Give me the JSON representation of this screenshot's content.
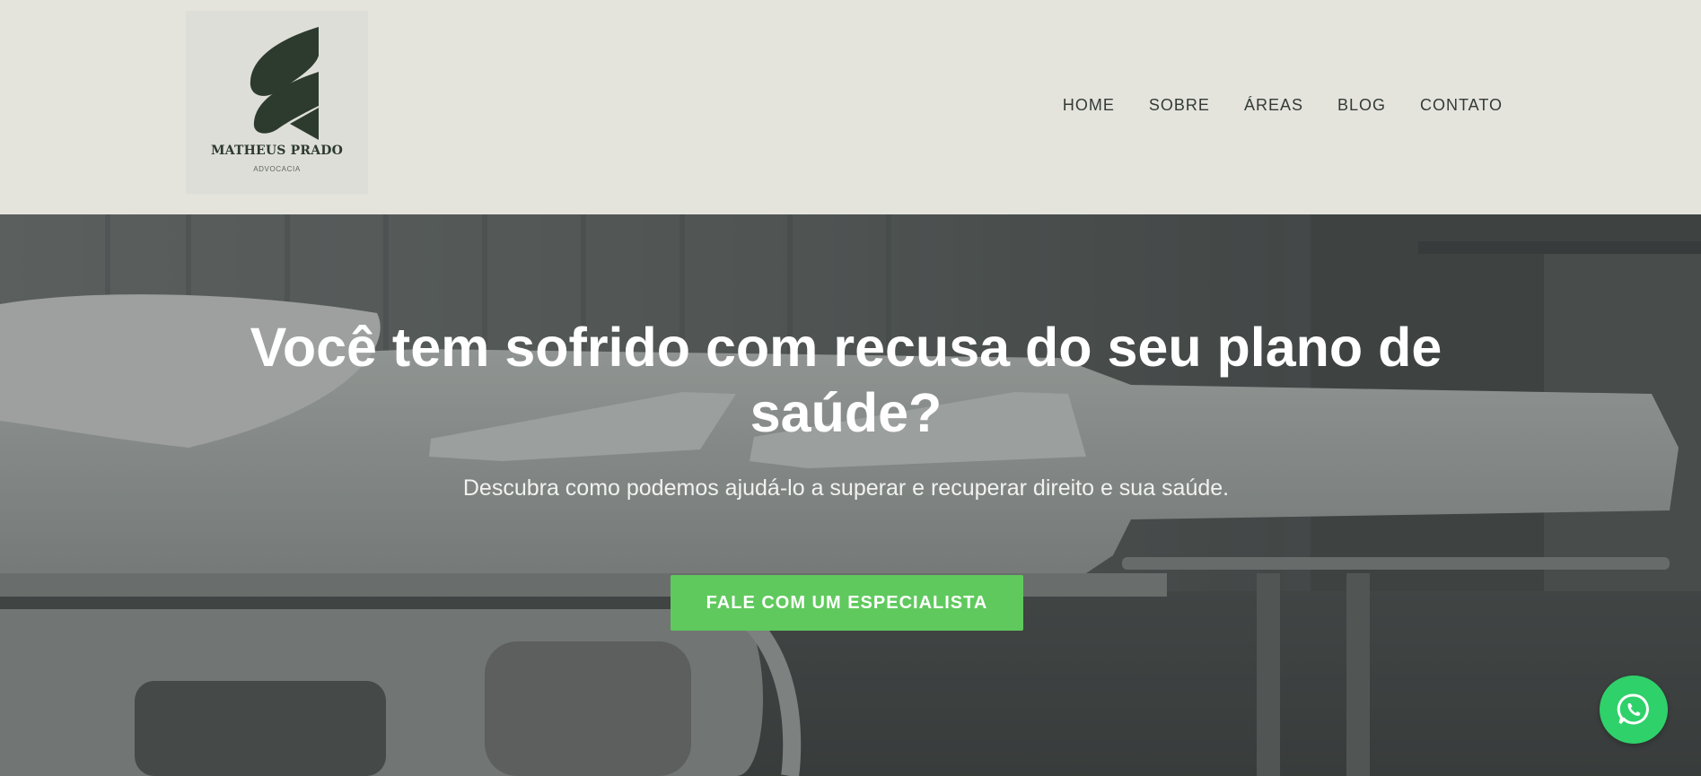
{
  "brand": {
    "name": "MATHEUS PRADO",
    "tagline": "ADVOCACIA",
    "logo_icon": "leaf-logo-icon"
  },
  "nav": {
    "items": [
      {
        "label": "HOME"
      },
      {
        "label": "SOBRE"
      },
      {
        "label": "ÁREAS"
      },
      {
        "label": "BLOG"
      },
      {
        "label": "CONTATO"
      }
    ]
  },
  "hero": {
    "title": "Você tem sofrido com recusa do seu plano de saúde?",
    "subtitle": "Descubra como podemos ajudá-lo a superar e recuperar direito e sua saúde.",
    "cta_label": "FALE COM UM ESPECIALISTA"
  },
  "floating": {
    "icon": "whatsapp-icon"
  },
  "colors": {
    "header_bg": "#e4e4dd",
    "logo_green": "#2d3b2f",
    "cta_green": "#5fc95d",
    "whatsapp_green": "#2fd16a",
    "nav_text": "#333a36"
  }
}
